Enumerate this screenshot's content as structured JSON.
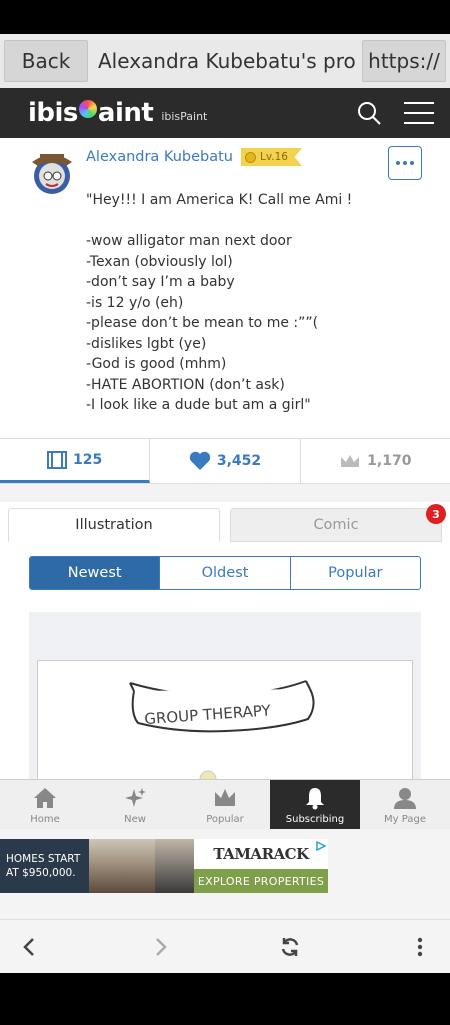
{
  "browser": {
    "back_label": "Back",
    "title": "Alexandra Kubebatu's profil...",
    "url_label": "https://"
  },
  "app_header": {
    "logo_text_left": "ibis",
    "logo_text_right": "aint",
    "logo_sub": "ibisPaint"
  },
  "profile": {
    "name": "Alexandra Kubebatu",
    "level": "Lv.16",
    "bio": "\"Hey!!! I am America K! Call me Ami !\n\n-wow alligator man next door\n-Texan (obviously lol)\n-don’t say I’m a baby\n-is 12 y/o (eh)\n-please don’t be mean to me :””(\n-dislikes lgbt (ye)\n-God is good (mhm)\n-HATE ABORTION (don’t ask)\n-I look like a dude but am a girl\""
  },
  "stats": {
    "artworks": "125",
    "likes": "3,452",
    "followers": "1,170"
  },
  "category_tabs": {
    "illustration": "Illustration",
    "comic": "Comic",
    "comic_badge": "3"
  },
  "sort": {
    "newest": "Newest",
    "oldest": "Oldest",
    "popular": "Popular"
  },
  "artwork": {
    "banner_text": "GROUP THERAPY"
  },
  "bottom_nav": {
    "home": "Home",
    "new": "New",
    "popular": "Popular",
    "subscribing": "Subscribing",
    "mypage": "My Page"
  },
  "ad": {
    "left_text": "HOMES START\nAT $950,000.",
    "brand": "TAMARACK",
    "cta": "EXPLORE PROPERTIES"
  },
  "colors": {
    "accent": "#3a7bbf",
    "active_sort": "#2e6aa6",
    "header": "#2b2b2b",
    "badge": "#e02020",
    "level_badge": "#f4d14f"
  }
}
